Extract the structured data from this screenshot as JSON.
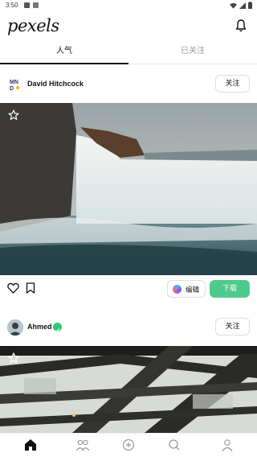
{
  "status_bar": {
    "time": "3:50"
  },
  "app": {
    "logo": "pexels"
  },
  "tabs": [
    {
      "label": "人气",
      "active": true
    },
    {
      "label": "已关注",
      "active": false
    }
  ],
  "posts": [
    {
      "author": "David Hitchcock",
      "avatar_text": "MN D",
      "follow_label": "关注",
      "edit_label": "编辑",
      "download_label": "下载"
    },
    {
      "author": "Ahmed",
      "follow_label": "关注"
    }
  ],
  "bottom_nav": [
    {
      "icon": "home-icon",
      "active": true
    },
    {
      "icon": "people-icon",
      "active": false
    },
    {
      "icon": "add-icon",
      "active": false
    },
    {
      "icon": "search-icon",
      "active": false
    },
    {
      "icon": "profile-icon",
      "active": false
    }
  ],
  "colors": {
    "accent_green": "#4ecb8c",
    "verified_green": "#2ecc71"
  }
}
